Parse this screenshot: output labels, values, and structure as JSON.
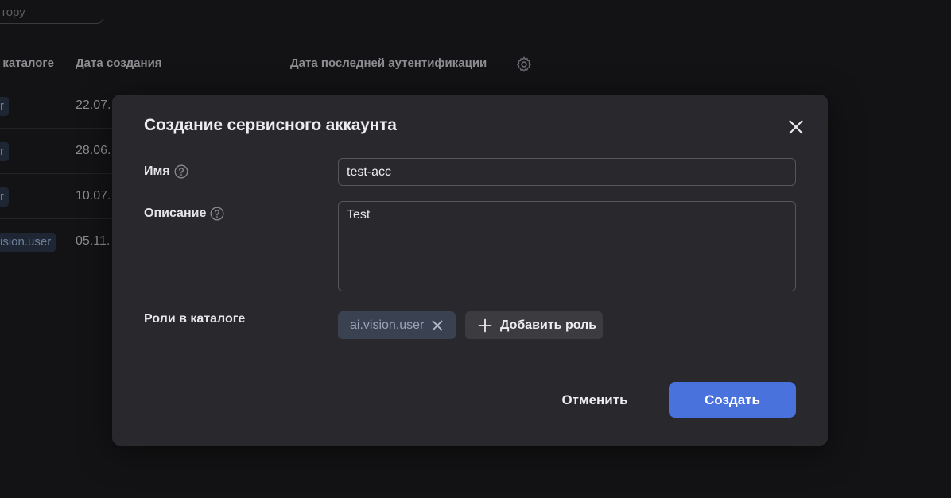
{
  "background": {
    "search_placeholder": "тору",
    "columns": {
      "roles": "в каталоге",
      "created": "Дата создания",
      "last_auth": "Дата последней аутентификации"
    },
    "rows": [
      {
        "role": "r",
        "date": "22.07."
      },
      {
        "role": "r",
        "date": "28.06."
      },
      {
        "role": "r",
        "date": "10.07."
      },
      {
        "role": "ision.user",
        "date": "05.11."
      }
    ]
  },
  "modal": {
    "title": "Создание сервисного аккаунта",
    "name_label": "Имя",
    "name_value": "test-acc",
    "description_label": "Описание",
    "description_value": "Test",
    "roles_label": "Роли в каталоге",
    "roles": [
      "ai.vision.user"
    ],
    "add_role_label": "Добавить роль",
    "cancel_label": "Отменить",
    "create_label": "Создать"
  },
  "colors": {
    "accent": "#4a72dd",
    "modal_bg": "#29292d",
    "page_bg": "#131315",
    "chip_bg": "#3a4150"
  },
  "icons": [
    "gear-icon",
    "close-icon",
    "help-icon",
    "remove-icon",
    "plus-icon"
  ]
}
